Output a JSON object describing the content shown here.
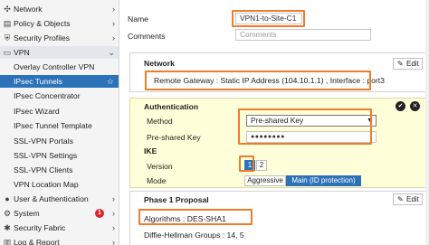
{
  "sidebar": {
    "items": [
      {
        "label": "Network",
        "icon": "network-icon",
        "glyph": "✣"
      },
      {
        "label": "Policy & Objects",
        "icon": "policy-icon",
        "glyph": "▤"
      },
      {
        "label": "Security Profiles",
        "icon": "shield-icon",
        "glyph": "⛨"
      },
      {
        "label": "VPN",
        "icon": "vpn-icon",
        "glyph": "▭"
      }
    ],
    "vpn_sub": [
      {
        "label": "Overlay Controller VPN"
      },
      {
        "label": "IPsec Tunnels",
        "selected": true
      },
      {
        "label": "IPsec Concentrator"
      },
      {
        "label": "IPsec Wizard"
      },
      {
        "label": "IPsec Tunnel Template"
      },
      {
        "label": "SSL-VPN Portals"
      },
      {
        "label": "SSL-VPN Settings"
      },
      {
        "label": "SSL-VPN Clients"
      },
      {
        "label": "VPN Location Map"
      }
    ],
    "bottom_items": [
      {
        "label": "User & Authentication",
        "icon": "user-icon",
        "glyph": "👤"
      },
      {
        "label": "System",
        "icon": "gear-icon",
        "glyph": "⚙",
        "badge": "1"
      },
      {
        "label": "Security Fabric",
        "icon": "fabric-icon",
        "glyph": "✱"
      },
      {
        "label": "Log & Report",
        "icon": "log-icon",
        "glyph": "▥"
      }
    ],
    "selected_color": "#2c72b9"
  },
  "form": {
    "name_label": "Name",
    "name_value": "VPN1-to-Site-C1",
    "comments_label": "Comments",
    "comments_placeholder": "Comments"
  },
  "network": {
    "title": "Network",
    "edit_label": "Edit",
    "summary": "Remote Gateway : Static IP Address (104.10.1.1) , Interface : port3"
  },
  "authentication": {
    "title": "Authentication",
    "method_label": "Method",
    "method_value": "Pre-shared Key",
    "psk_label": "Pre-shared Key",
    "psk_value": "●●●●●●●●",
    "ike_title": "IKE",
    "version_label": "Version",
    "version_options": [
      "1",
      "2"
    ],
    "version_selected": "1",
    "mode_label": "Mode",
    "mode_options": [
      "Aggressive",
      "Main (ID protection)"
    ],
    "mode_selected": "Main (ID protection)",
    "highlight_color": "#ffffd9"
  },
  "phase1": {
    "title": "Phase 1 Proposal",
    "edit_label": "Edit",
    "algorithms": "Algorithms : DES-SHA1",
    "dh_groups": "Diffie-Hellman Groups : 14, 5"
  },
  "accent_color": "#f07c2a"
}
